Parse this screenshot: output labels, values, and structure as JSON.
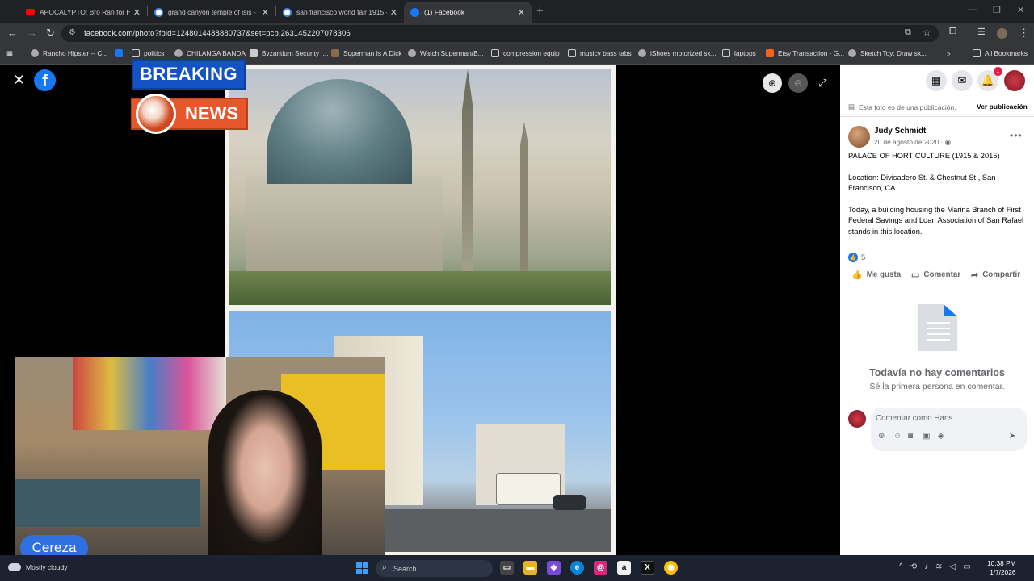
{
  "tabs": [
    {
      "title": "APOCALYPTO: Bro Ran for His L",
      "color": "#ff0000"
    },
    {
      "title": "grand canyon temple of isis - G",
      "color": "#ffffff"
    },
    {
      "title": "san francisco world fair 1915 -",
      "color": "#ffffff"
    },
    {
      "title": "(1) Facebook",
      "color": "#1877f2"
    }
  ],
  "address": {
    "url": "facebook.com/photo?fbid=1248014488880737&set=pcb.2631452207078306"
  },
  "bookmarks": [
    {
      "label": "Rancho Hipster -- C..."
    },
    {
      "label": "politics"
    },
    {
      "label": "CHILANGA BANDA"
    },
    {
      "label": "Byzantium Security I..."
    },
    {
      "label": "Superman Is A Dick"
    },
    {
      "label": "Watch Superman/B..."
    },
    {
      "label": "compression equip"
    },
    {
      "label": "musicv bass tabs"
    },
    {
      "label": "iShoes motorized sk..."
    },
    {
      "label": "laptops"
    },
    {
      "label": "Etsy Transaction - G..."
    },
    {
      "label": "Sketch Toy: Draw sk..."
    },
    {
      "label": "All Bookmarks"
    }
  ],
  "overlay": {
    "breaking": "BREAKING",
    "news": "NEWS",
    "streamer": "Cereza"
  },
  "panel": {
    "notification_count": "1",
    "publication_note": "Esta foto es de una publicación.",
    "see_publication": "Ver publicación",
    "author": "Judy Schmidt",
    "date": "20 de agosto de 2020 ·",
    "text": [
      "PALACE OF HORTICULTURE (1915 & 2015)",
      "Location: Divisadero St. & Chestnut St., San Francisco, CA",
      "Today, a building housing the Marina Branch of First Federal Savings and Loan Association of San Rafael stands in this location."
    ],
    "likes": "5",
    "actions": {
      "like": "Me gusta",
      "comment": "Comentar",
      "share": "Compartir"
    },
    "no_comments": "Todavía no hay comentarios",
    "be_first": "Sé la primera persona en comentar.",
    "comment_placeholder": "Comentar como Hans"
  },
  "taskbar": {
    "weather": "Mostly cloudy",
    "search_placeholder": "Search",
    "time": "10:38 PM",
    "date": "1/7/2026"
  }
}
